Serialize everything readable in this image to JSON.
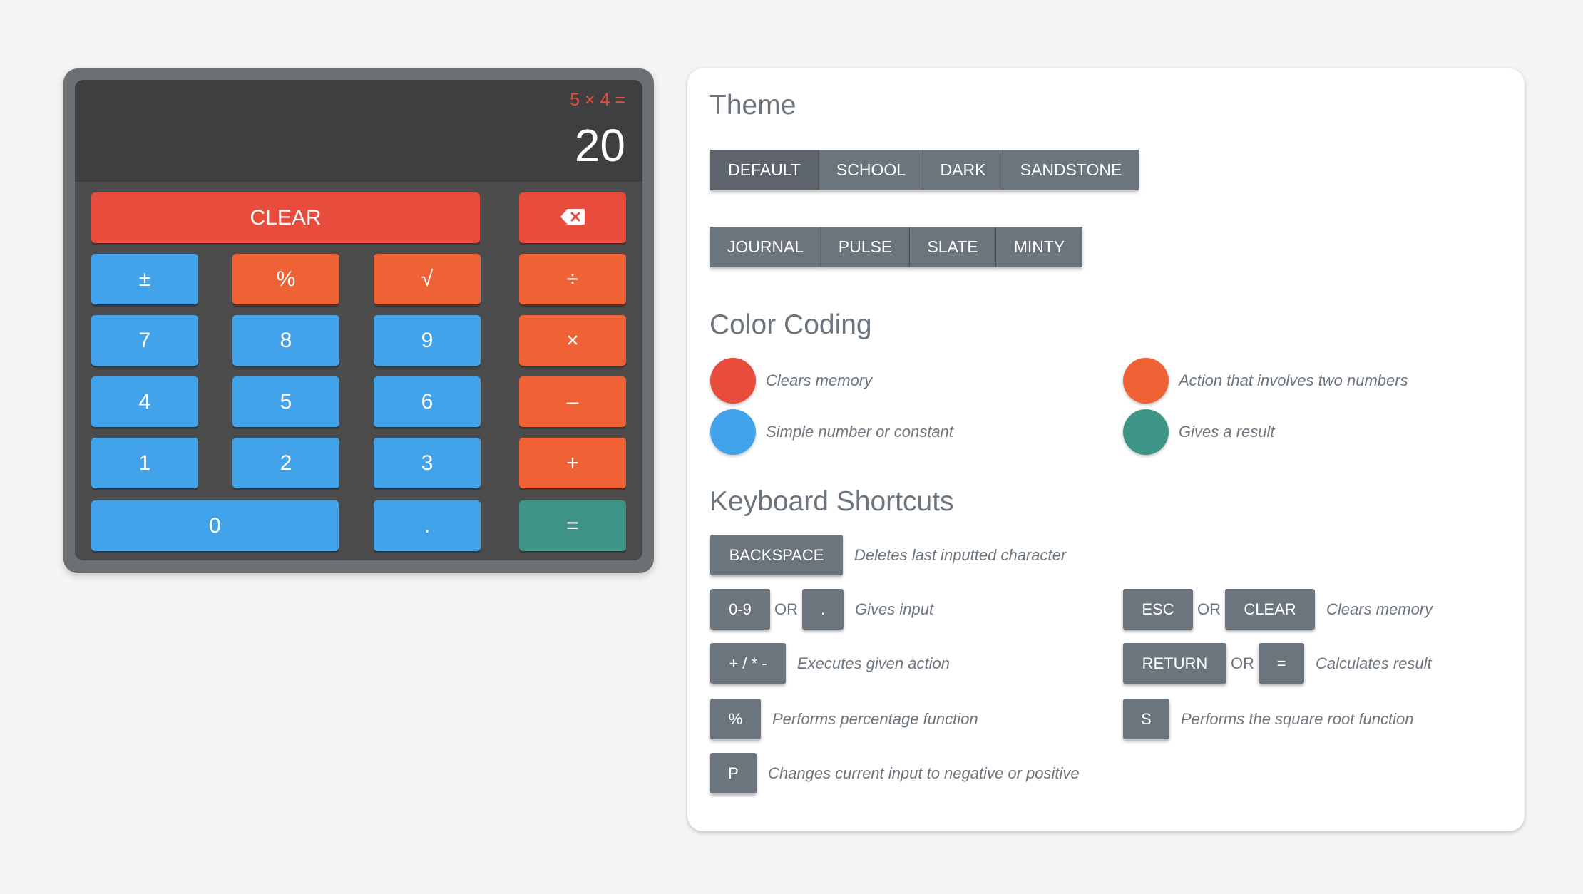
{
  "calculator": {
    "expression": "5 × 4 =",
    "result": "20",
    "keys": {
      "clear": "CLEAR",
      "backspace_icon": "backspace-icon",
      "plus_minus": "±",
      "percent": "%",
      "sqrt": "√",
      "divide": "÷",
      "seven": "7",
      "eight": "8",
      "nine": "9",
      "multiply": "×",
      "four": "4",
      "five": "5",
      "six": "6",
      "minus": "–",
      "one": "1",
      "two": "2",
      "three": "3",
      "plus": "+",
      "zero": "0",
      "dot": ".",
      "equals": "="
    }
  },
  "theme": {
    "heading": "Theme",
    "row1": [
      "DEFAULT",
      "SCHOOL",
      "DARK",
      "SANDSTONE"
    ],
    "row2": [
      "JOURNAL",
      "PULSE",
      "SLATE",
      "MINTY"
    ],
    "selected": "DEFAULT"
  },
  "color_coding": {
    "heading": "Color Coding",
    "items": [
      {
        "label": "Clears memory",
        "color": "#e74c3c"
      },
      {
        "label": "Action that involves two numbers",
        "color": "#ee6236"
      },
      {
        "label": "Simple number or constant",
        "color": "#43a3ea"
      },
      {
        "label": "Gives a result",
        "color": "#3f9488"
      }
    ]
  },
  "shortcuts": {
    "heading": "Keyboard Shortcuts",
    "or_label": "OR",
    "backspace": {
      "key": "BACKSPACE",
      "desc": "Deletes last inputted character"
    },
    "digits": {
      "key1": "0-9",
      "key2": ".",
      "desc": "Gives input"
    },
    "clear": {
      "key1": "ESC",
      "key2": "CLEAR",
      "desc": "Clears memory"
    },
    "ops": {
      "key": "+ / * -",
      "desc": "Executes given action"
    },
    "result": {
      "key1": "RETURN",
      "key2": "=",
      "desc": "Calculates result"
    },
    "percent": {
      "key": "%",
      "desc": "Performs percentage function"
    },
    "sqrt": {
      "key": "S",
      "desc": "Performs the square root function"
    },
    "negate": {
      "key": "P",
      "desc": "Changes current input to negative or positive"
    }
  },
  "colors": {
    "red": "#e74c3c",
    "orange": "#ee6236",
    "blue": "#43a3ea",
    "teal": "#3f9488",
    "gray": "#6c757d"
  }
}
